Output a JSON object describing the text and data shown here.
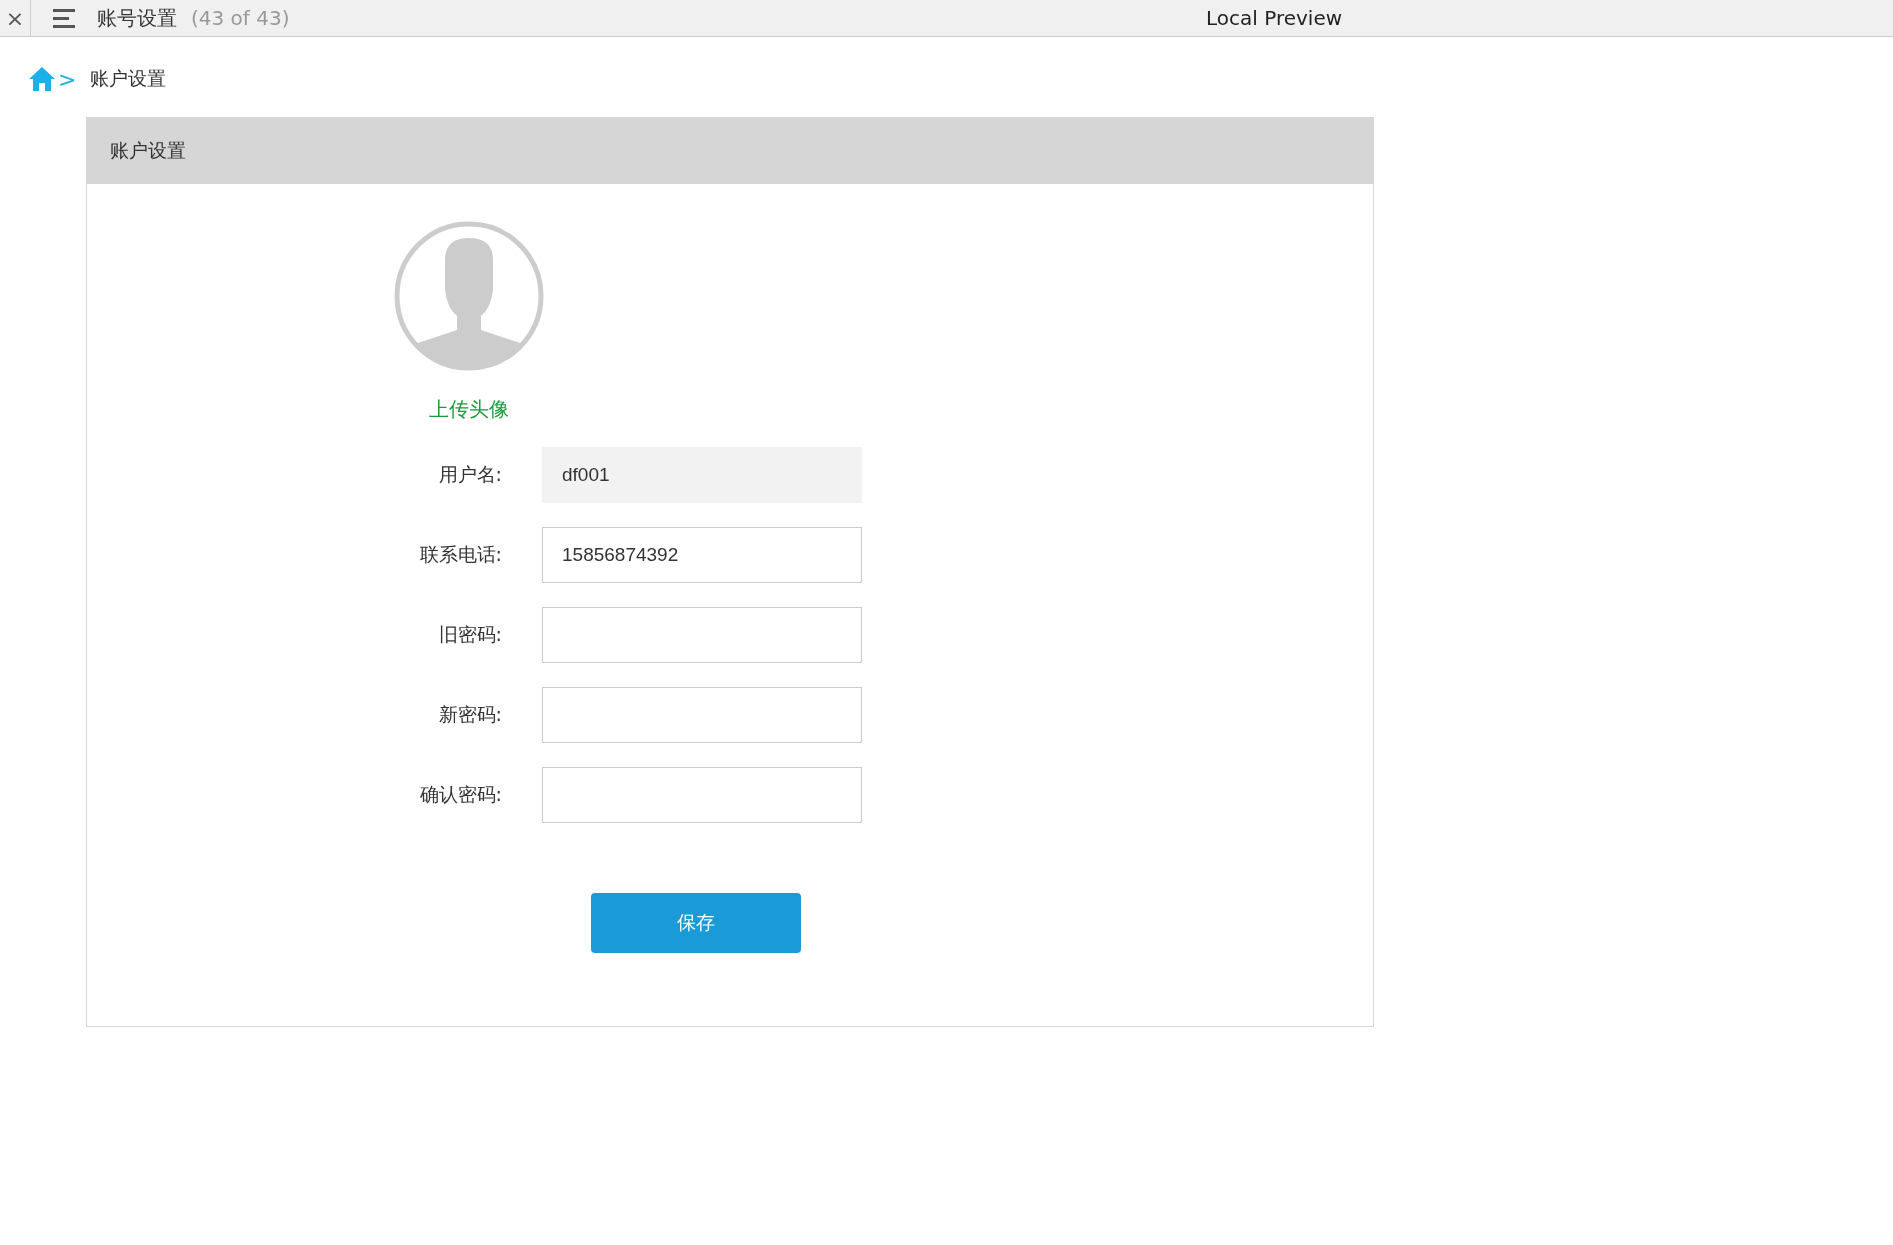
{
  "titlebar": {
    "close": "×",
    "doc_title": "账号设置",
    "counter": "(43 of 43)",
    "app_title": "Local Preview"
  },
  "breadcrumb": {
    "separator": ">",
    "label": "账户设置"
  },
  "panel": {
    "title": "账户设置",
    "upload_link": "上传头像",
    "fields": [
      {
        "label": "用户名:",
        "value": "df001",
        "disabled": true
      },
      {
        "label": "联系电话:",
        "value": "15856874392",
        "disabled": false
      },
      {
        "label": "旧密码:",
        "disabled": false
      },
      {
        "label": "新密码:",
        "disabled": false
      },
      {
        "label": "确认密码:",
        "disabled": false
      }
    ],
    "save_button": "保存"
  }
}
